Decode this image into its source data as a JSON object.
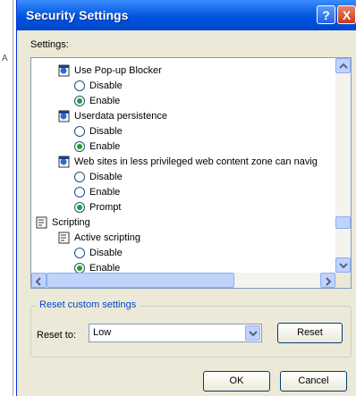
{
  "window": {
    "title": "Security Settings",
    "help_glyph": "?",
    "close_glyph": "X"
  },
  "background_fragment": "A",
  "settings_label": "Settings:",
  "tree": {
    "popup_blocker": {
      "label": "Use Pop-up Blocker",
      "options": [
        "Disable",
        "Enable"
      ],
      "selected": "Enable"
    },
    "userdata": {
      "label": "Userdata persistence",
      "options": [
        "Disable",
        "Enable"
      ],
      "selected": "Enable"
    },
    "less_privileged": {
      "label": "Web sites in less privileged web content zone can navig",
      "options": [
        "Disable",
        "Enable",
        "Prompt"
      ],
      "selected": "Prompt"
    },
    "scripting": {
      "label": "Scripting"
    },
    "active_scripting": {
      "label": "Active scripting",
      "options": [
        "Disable",
        "Enable"
      ],
      "selected": "Enable"
    }
  },
  "reset_group": {
    "title": "Reset custom settings",
    "reset_to_label": "Reset to:",
    "dropdown_value": "Low",
    "reset_button": "Reset"
  },
  "buttons": {
    "ok": "OK",
    "cancel": "Cancel"
  },
  "colors": {
    "title_bar": "#0054e3",
    "dialog_bg": "#ece9d8",
    "selected_radio": "#21a121",
    "group_title": "#0046d5"
  }
}
